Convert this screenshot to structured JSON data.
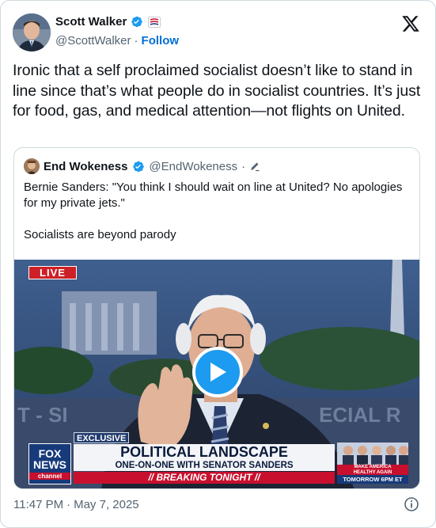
{
  "author": {
    "name": "Scott Walker",
    "handle": "@ScottWalker",
    "follow_label": "Follow",
    "separator": "·"
  },
  "tweet": {
    "text": "Ironic that a self proclaimed socialist doesn’t like to stand in line since that’s what people do in socialist countries. It’s just for food, gas, and medical attention—not flights on United."
  },
  "quote": {
    "author_name": "End Wokeness",
    "author_handle": "@EndWokeness",
    "separator": "·",
    "text_lines": [
      "Bernie Sanders: \"You think I should wait on line at United? No apologies",
      "for my private jets.\"",
      "Socialists are beyond parody"
    ]
  },
  "video": {
    "live_label": "LIVE",
    "exclusive_label": "EXCLUSIVE",
    "headline": "POLITICAL LANDSCAPE",
    "subheadline": "ONE-ON-ONE WITH SENATOR SANDERS",
    "breaking": "// BREAKING TONIGHT //",
    "network_line1": "FOX",
    "network_line2": "NEWS",
    "network_line3": "channel",
    "promo_line1": "MAKE AMERICA",
    "promo_line2": "HEALTHY AGAIN",
    "promo_time": "TOMORROW 6PM ET"
  },
  "footer": {
    "time": "11:47 PM",
    "separator": "·",
    "date": "May 7, 2025"
  },
  "colors": {
    "accent": "#1d9bf0",
    "follow": "#006fd6",
    "secondary_text": "#536471",
    "border": "#cfd9de"
  }
}
